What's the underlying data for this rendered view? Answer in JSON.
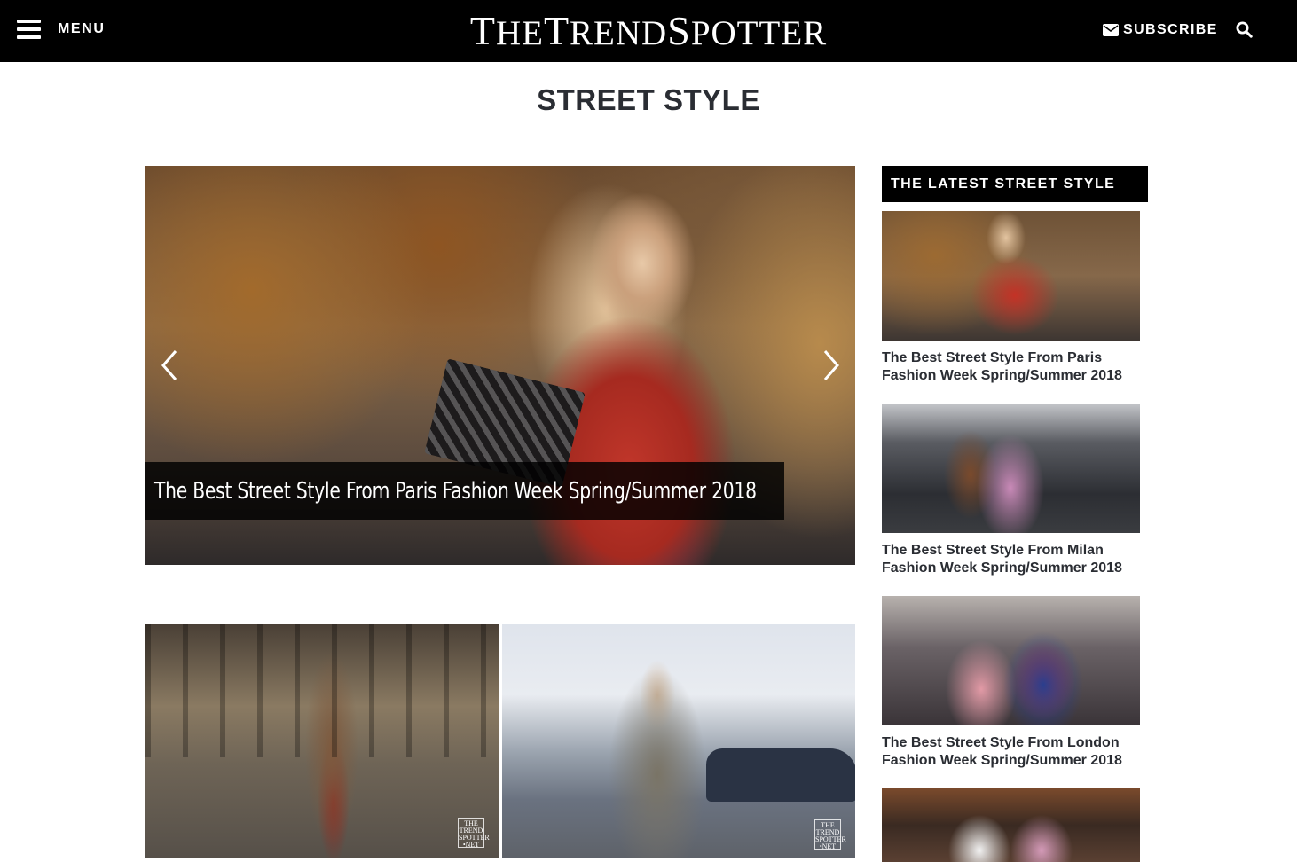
{
  "header": {
    "menu_label": "MENU",
    "logo_parts": [
      "T",
      "HE",
      "T",
      "REND",
      "S",
      "POTTER"
    ],
    "subscribe_label": "SUBSCRIBE"
  },
  "page": {
    "title": "STREET STYLE"
  },
  "hero": {
    "caption": "The Best Street Style From Paris Fashion Week Spring/Summer 2018"
  },
  "sidebar": {
    "heading": "THE LATEST STREET STYLE",
    "items": [
      {
        "title": "The Best Street Style From Paris Fashion Week Spring/Summer 2018"
      },
      {
        "title": "The Best Street Style From Milan Fashion Week Spring/Summer 2018"
      },
      {
        "title": "The Best Street Style From London Fashion Week Spring/Summer 2018"
      },
      {
        "title": ""
      }
    ]
  },
  "watermark": {
    "line1": "THE",
    "line2": "TREND",
    "line3": "SPOTTER",
    "line4": "•NET"
  },
  "icons": {
    "menu": "hamburger-icon",
    "subscribe": "envelope-icon",
    "search": "search-icon",
    "prev": "chevron-left-icon",
    "next": "chevron-right-icon"
  },
  "colors": {
    "header_bg": "#000000",
    "title_text": "#2a2d33",
    "caption_bg": "#000000"
  }
}
